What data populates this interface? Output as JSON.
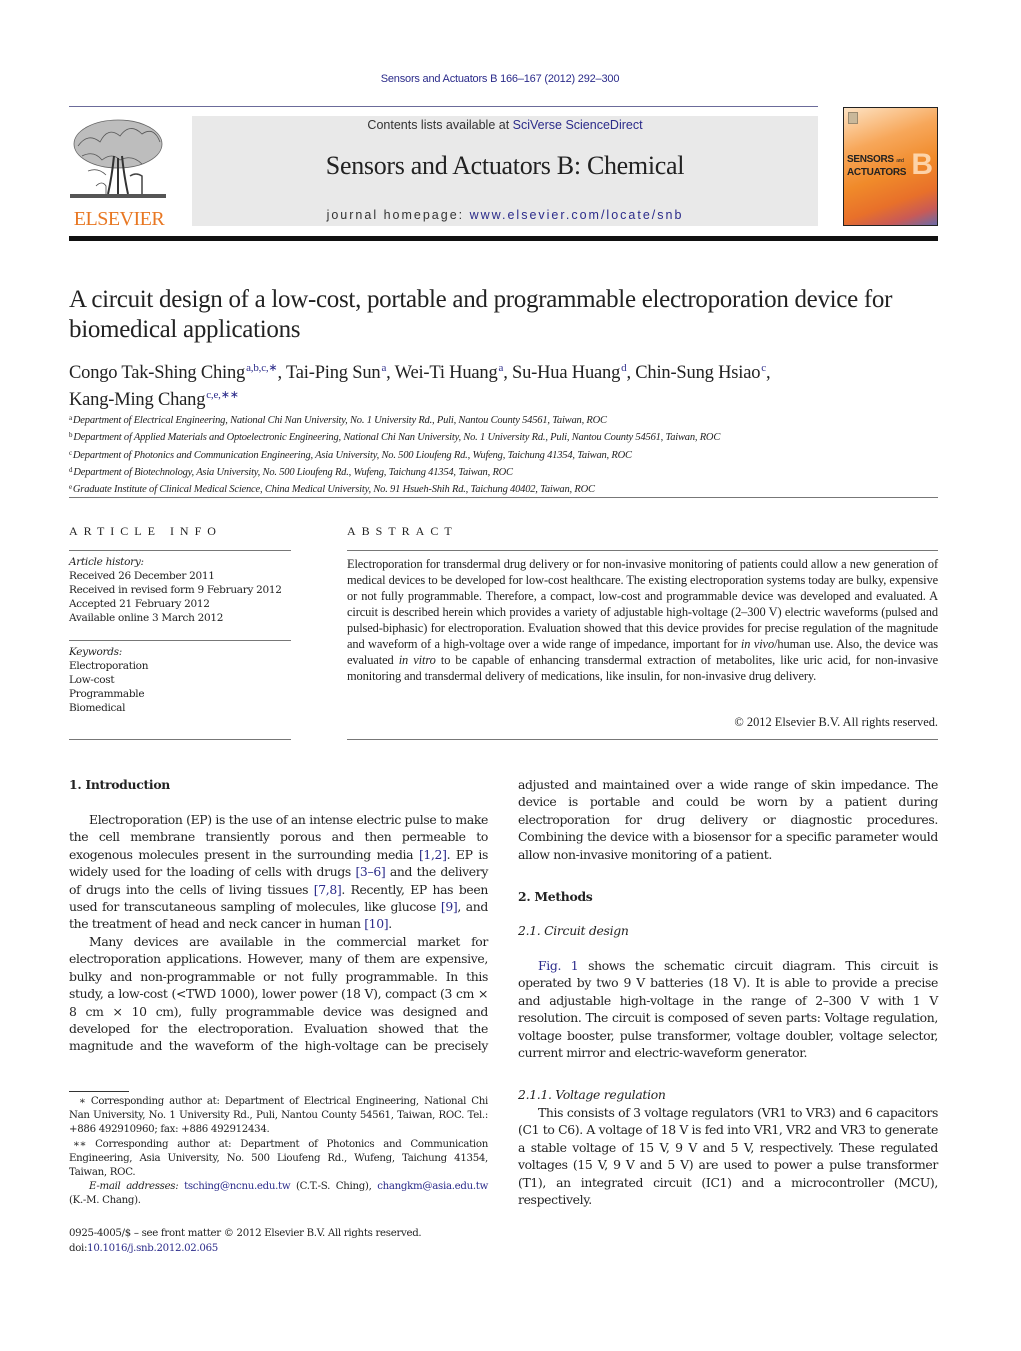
{
  "header": {
    "journal_reference": "Sensors and Actuators B 166–167 (2012) 292–300",
    "publisher_logo_text": "ELSEVIER",
    "contents_prefix": "Contents lists available at ",
    "contents_link": "SciVerse ScienceDirect",
    "journal_title": "Sensors and Actuators B: Chemical",
    "homepage_prefix": "journal homepage: ",
    "homepage_link": "www.elsevier.com/locate/snb",
    "cover": {
      "title_line1": "SENSORS",
      "title_and": "and",
      "title_line2": "ACTUATORS",
      "letter": "B"
    },
    "colors": {
      "link": "#2b2b8a",
      "elsevier_orange": "#e87722",
      "masthead_bg": "#e9e9e9"
    }
  },
  "article": {
    "title": "A circuit design of a low-cost, portable and programmable electroporation device for biomedical applications",
    "authors": [
      {
        "name": "Congo Tak-Shing Ching",
        "marks": "a,b,c,∗",
        "sep": ", "
      },
      {
        "name": "Tai-Ping Sun",
        "marks": "a",
        "sep": ", "
      },
      {
        "name": "Wei-Ti Huang",
        "marks": "a",
        "sep": ", "
      },
      {
        "name": "Su-Hua Huang",
        "marks": "d",
        "sep": ", "
      },
      {
        "name": "Chin-Sung Hsiao",
        "marks": "c",
        "sep": ", "
      },
      {
        "name": "Kang-Ming Chang",
        "marks": "c,e,∗∗",
        "sep": ""
      }
    ],
    "affiliations": [
      {
        "mark": "a",
        "text": "Department of Electrical Engineering, National Chi Nan University, No. 1 University Rd., Puli, Nantou County 54561, Taiwan, ROC"
      },
      {
        "mark": "b",
        "text": "Department of Applied Materials and Optoelectronic Engineering, National Chi Nan University, No. 1 University Rd., Puli, Nantou County 54561, Taiwan, ROC"
      },
      {
        "mark": "c",
        "text": "Department of Photonics and Communication Engineering, Asia University, No. 500 Lioufeng Rd., Wufeng, Taichung 41354, Taiwan, ROC"
      },
      {
        "mark": "d",
        "text": "Department of Biotechnology, Asia University, No. 500 Lioufeng Rd., Wufeng, Taichung 41354, Taiwan, ROC"
      },
      {
        "mark": "e",
        "text": "Graduate Institute of Clinical Medical Science, China Medical University, No. 91 Hsueh-Shih Rd., Taichung 40402, Taiwan, ROC"
      }
    ]
  },
  "article_info": {
    "heading": "ARTICLE INFO",
    "history_label": "Article history:",
    "history": [
      "Received 26 December 2011",
      "Received in revised form 9 February 2012",
      "Accepted 21 February 2012",
      "Available online 3 March 2012"
    ],
    "keywords_label": "Keywords:",
    "keywords": [
      "Electroporation",
      "Low-cost",
      "Programmable",
      "Biomedical"
    ]
  },
  "abstract": {
    "heading": "ABSTRACT",
    "part1": "Electroporation for transdermal drug delivery or for non-invasive monitoring of patients could allow a new generation of medical devices to be developed for low-cost healthcare. The existing electroporation systems today are bulky, expensive or not fully programmable. Therefore, a compact, low-cost and programmable device was developed and evaluated. A circuit is described herein which provides a variety of adjustable high-voltage (2–300 V) electric waveforms (pulsed and pulsed-biphasic) for electroporation. Evaluation showed that this device provides for precise regulation of the magnitude and waveform of a high-voltage over a wide range of impedance, important for ",
    "italic1": "in vivo",
    "part2": "/human use. Also, the device was evaluated ",
    "italic2": "in vitro",
    "part3": " to be capable of enhancing transdermal extraction of metabolites, like uric acid, for non-invasive monitoring and transdermal delivery of medications, like insulin, for non-invasive drug delivery.",
    "copyright": "© 2012 Elsevier B.V. All rights reserved."
  },
  "body": {
    "intro_heading": "1.  Introduction",
    "intro_p1": {
      "t1": "Electroporation (EP) is the use of an intense electric pulse to make the cell membrane transiently porous and then permeable to exogenous molecules present in the surrounding media ",
      "r1": "[1,2]",
      "t2": ". EP is widely used for the loading of cells with drugs ",
      "r2": "[3–6]",
      "t3": " and the delivery of drugs into the cells of living tissues ",
      "r3": "[7,8]",
      "t4": ". Recently, EP has been used for transcutaneous sampling of molecules, like glucose ",
      "r4": "[9]",
      "t5": ", and the treatment of head and neck cancer in human ",
      "r5": "[10]",
      "t6": "."
    },
    "intro_p2": "Many devices are available in the commercial market for electroporation applications. However, many of them are expensive, bulky and non-programmable or not fully programmable. In this study, a low-cost (<TWD 1000), lower power (18 V), compact (3 cm × 8 cm × 10 cm), fully programmable device was designed and developed for the electroporation. Evaluation showed that the magnitude and the waveform of the high-voltage can be precisely",
    "intro_p2_cont": "adjusted and maintained over a wide range of skin impedance. The device is portable and could be worn by a patient during electroporation for drug delivery or diagnostic procedures. Combining the device with a biosensor for a specific parameter would allow non-invasive monitoring of a patient.",
    "methods_heading": "2.  Methods",
    "circuit_heading": "2.1.  Circuit design",
    "circuit_p1_link": "Fig. 1",
    "circuit_p1": " shows the schematic circuit diagram. This circuit is operated by two 9 V batteries (18 V). It is able to provide a precise and adjustable high-voltage in the range of 2–300 V with 1 V resolution. The circuit is composed of seven parts: Voltage regulation, voltage booster, pulse transformer, voltage doubler, voltage selector, current mirror and electric-waveform generator.",
    "voltage_heading": "2.1.1.  Voltage regulation",
    "voltage_p1": "This consists of 3 voltage regulators (VR1 to VR3) and 6 capacitors (C1 to C6). A voltage of 18 V is fed into VR1, VR2 and VR3 to generate a stable voltage of 15 V, 9 V and 5 V, respectively. These regulated voltages (15 V, 9 V and 5 V) are used to power a pulse transformer (T1), an integrated circuit (IC1) and a microcontroller (MCU), respectively."
  },
  "footnotes": {
    "fn1": "∗ Corresponding author at: Department of Electrical Engineering, National Chi Nan University, No. 1 University Rd., Puli, Nantou County 54561, Taiwan, ROC. Tel.: +886 492910960; fax: +886 492912434.",
    "fn2": "∗∗ Corresponding author at: Department of Photonics and Communication Engineering, Asia University, No. 500 Lioufeng Rd., Wufeng, Taichung 41354, Taiwan, ROC.",
    "email_label": "E-mail addresses: ",
    "email1": "tsching@ncnu.edu.tw",
    "email1_name": " (C.T.-S. Ching), ",
    "email2": "changkm@asia.edu.tw",
    "email2_name": " (K.-M. Chang).",
    "issn_line": "0925-4005/$ – see front matter © 2012 Elsevier B.V. All rights reserved.",
    "doi_prefix": "doi:",
    "doi": "10.1016/j.snb.2012.02.065"
  }
}
